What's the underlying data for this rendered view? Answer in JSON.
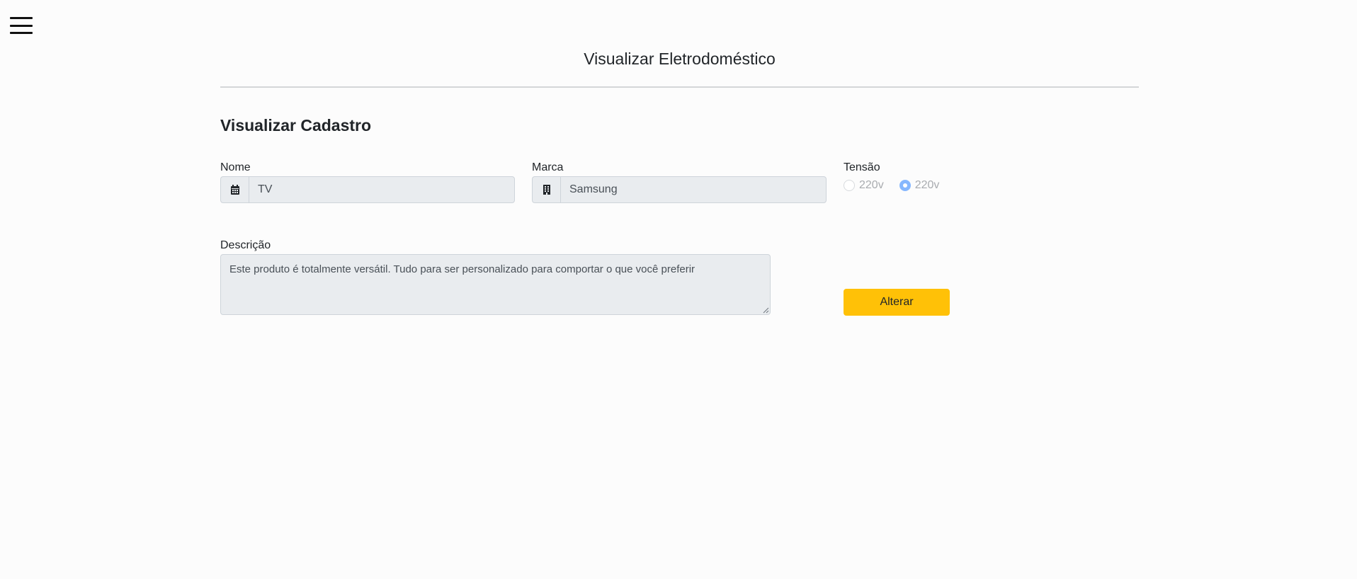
{
  "header": {
    "menu_icon": "hamburger-menu-icon",
    "title": "Visualizar Eletrodoméstico"
  },
  "form": {
    "section_title": "Visualizar Cadastro",
    "nome": {
      "label": "Nome",
      "value": "TV",
      "icon": "calendar-icon"
    },
    "marca": {
      "label": "Marca",
      "value": "Samsung",
      "icon": "building-icon"
    },
    "tensao": {
      "label": "Tensão",
      "options": [
        {
          "label": "220v",
          "checked": false
        },
        {
          "label": "220v",
          "checked": true
        }
      ]
    },
    "descricao": {
      "label": "Descrição",
      "value": "Este produto é totalmente versátil. Tudo para ser personalizado para comportar o que você preferir"
    },
    "submit_label": "Alterar"
  },
  "colors": {
    "background": "#fcfcfc",
    "button_warning": "#ffc107",
    "input_disabled_bg": "#e9ecef",
    "radio_checked": "#86b7fe"
  }
}
